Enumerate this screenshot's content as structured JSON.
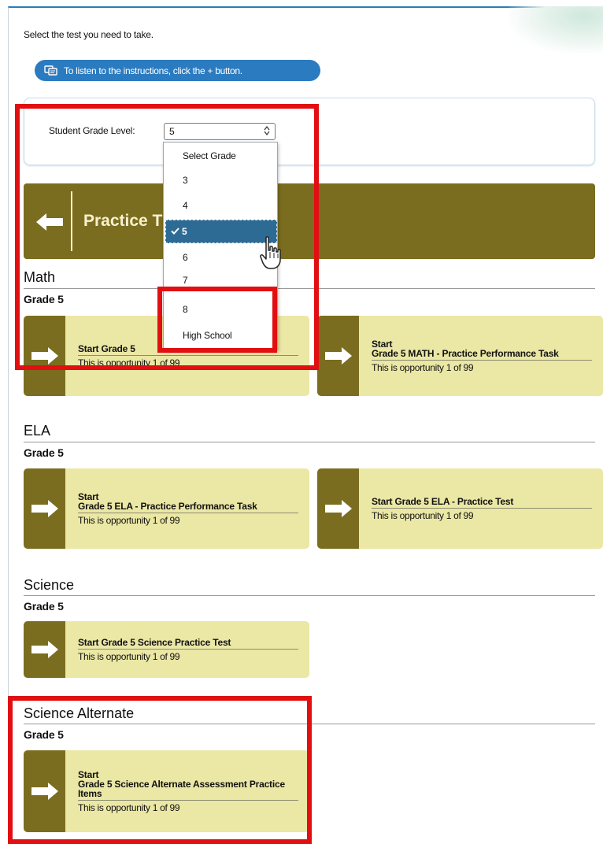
{
  "instruction": "Select the test you need to take.",
  "tts_button": {
    "label": "To listen to the instructions, click the + button."
  },
  "grade_selector": {
    "label": "Student Grade Level:",
    "value": "5",
    "options": [
      "Select Grade",
      "3",
      "4",
      "5",
      "6",
      "7",
      "8",
      "High School"
    ],
    "selected": "5"
  },
  "banner": {
    "title": "Practice T"
  },
  "sections": [
    {
      "title": "Math",
      "grade": "Grade 5",
      "cards": [
        {
          "title": "Start  Grade 5",
          "opportunity": "This is opportunity 1 of 99"
        },
        {
          "title": "Start\nGrade 5 MATH - Practice Performance Task",
          "opportunity": "This is opportunity 1 of 99"
        }
      ]
    },
    {
      "title": "ELA",
      "grade": "Grade 5",
      "cards": [
        {
          "title": "Start\nGrade 5 ELA - Practice Performance Task",
          "opportunity": "This is opportunity 1 of 99"
        },
        {
          "title": "Start  Grade 5 ELA - Practice Test",
          "opportunity": "This is opportunity 1 of 99"
        }
      ]
    },
    {
      "title": "Science",
      "grade": "Grade 5",
      "cards": [
        {
          "title": "Start  Grade 5 Science Practice Test",
          "opportunity": "This is opportunity 1 of 99"
        }
      ]
    },
    {
      "title": "Science Alternate",
      "grade": "Grade 5",
      "cards": [
        {
          "title": "Start\nGrade 5 Science Alternate Assessment Practice Items",
          "opportunity": "This is opportunity 1 of 99"
        }
      ]
    }
  ],
  "colors": {
    "accent_olive": "#7b6d1f",
    "card_bg": "#ebe7a5",
    "tts_blue": "#2b7bc0",
    "highlight_red": "#e10f12",
    "selected_option": "#2e6b94"
  }
}
